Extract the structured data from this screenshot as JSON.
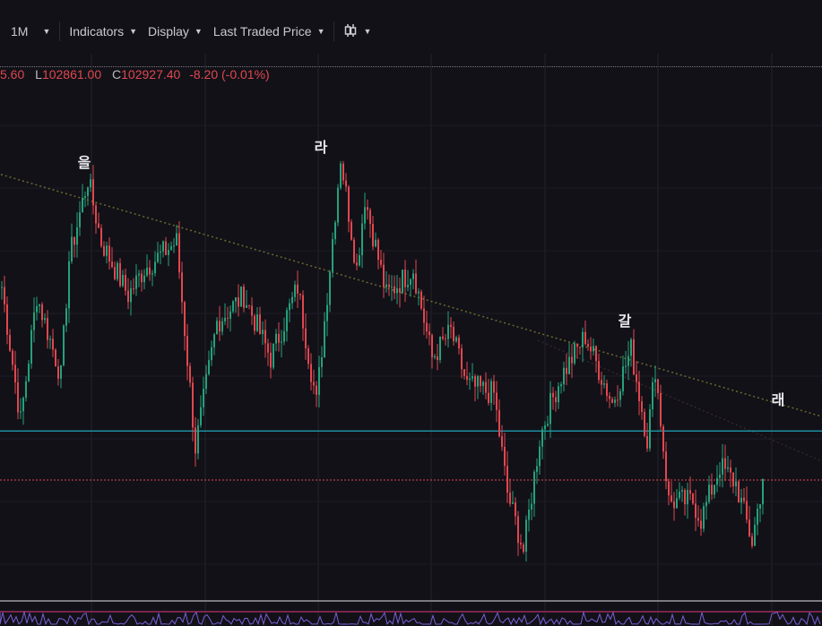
{
  "toolbar": {
    "interval": "1M",
    "indicators": "Indicators",
    "display": "Display",
    "price_source": "Last Traded Price",
    "chart_type_icon": "candlestick-icon"
  },
  "ohlc": {
    "high_partial": "5.60",
    "low_label": "L",
    "low": "102861.00",
    "close_label": "C",
    "close": "102927.40",
    "change": "-8.20 (-0.01%)"
  },
  "colors": {
    "up": "#26a17b",
    "down": "#e0474f",
    "support": "#1fa6b8",
    "last_price": "#e0474f",
    "trend": "#6b6a2e",
    "rsi": "#7b5fd6",
    "rsi_band": "#9c2a5c"
  },
  "chart_data": {
    "type": "candlestick",
    "units": "relative price level (0 = chart bottom, 100 = chart top)",
    "ylim": [
      0,
      100
    ],
    "bar_count": 290,
    "path": [
      [
        0,
        56.6
      ],
      [
        7,
        30.1
      ],
      [
        13,
        54.9
      ],
      [
        22,
        38.9
      ],
      [
        25,
        61.9
      ],
      [
        32,
        77.9
      ],
      [
        37,
        65.5
      ],
      [
        47,
        54.9
      ],
      [
        53,
        60.2
      ],
      [
        65,
        65.5
      ],
      [
        72,
        24.8
      ],
      [
        80,
        49.6
      ],
      [
        90,
        54.9
      ],
      [
        100,
        42.5
      ],
      [
        110,
        56.6
      ],
      [
        117,
        33.6
      ],
      [
        126,
        82.3
      ],
      [
        132,
        60.2
      ],
      [
        135,
        74.3
      ],
      [
        143,
        54.9
      ],
      [
        153,
        60.2
      ],
      [
        160,
        42.5
      ],
      [
        167,
        47.8
      ],
      [
        173,
        37.2
      ],
      [
        183,
        35.4
      ],
      [
        188,
        15.9
      ],
      [
        194,
        4.4
      ],
      [
        200,
        26.5
      ],
      [
        203,
        31.9
      ],
      [
        208,
        38.9
      ],
      [
        217,
        46.9
      ],
      [
        227,
        33.6
      ],
      [
        234,
        44.2
      ],
      [
        240,
        26.5
      ],
      [
        243,
        40.7
      ],
      [
        248,
        14.2
      ],
      [
        257,
        14.2
      ],
      [
        260,
        10.6
      ],
      [
        267,
        21.2
      ],
      [
        273,
        17.7
      ],
      [
        279,
        6.2
      ],
      [
        283,
        18.6
      ]
    ],
    "support_level": 28.1,
    "last_price_level": 18.4,
    "trendline": [
      [
        0,
        78.8
      ],
      [
        305,
        31.0
      ]
    ],
    "wave_labels": [
      {
        "text": "을",
        "bar": 31,
        "level": 81.5
      },
      {
        "text": "라",
        "bar": 119,
        "level": 84.4
      },
      {
        "text": "갈",
        "bar": 232,
        "level": 50.1
      },
      {
        "text": "래",
        "bar": 289,
        "level": 34.5
      }
    ]
  }
}
